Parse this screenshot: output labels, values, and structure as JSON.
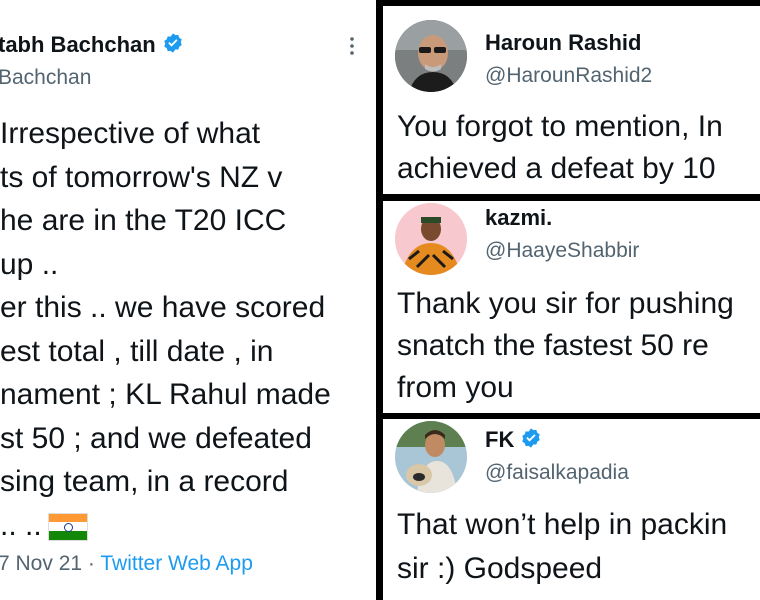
{
  "left_tweet": {
    "name": "tabh Bachchan",
    "handle": "Bachchan",
    "lines": [
      "Irrespective of what",
      "ts of tomorrow's NZ v",
      "he are in the T20 ICC",
      "up ..",
      "er this .. we have scored",
      "est total , till date , in",
      "nament ; KL Rahul made",
      "st 50 ; and we defeated",
      "sing team, in a record",
      ".. .."
    ],
    "date": "7 Nov 21",
    "separator": "·",
    "source": "Twitter Web App"
  },
  "replies": [
    {
      "name": "Haroun Rashid",
      "handle": "@HarounRashid2",
      "lines": [
        "You forgot to mention, In",
        "achieved a defeat by 10"
      ]
    },
    {
      "name": "kazmi.",
      "handle": "@HaayeShabbir",
      "lines": [
        "Thank you sir for pushing",
        "snatch the fastest 50 re",
        "from you"
      ]
    },
    {
      "name": "FK",
      "handle": "@faisalkapadia",
      "lines": [
        "That won’t help in packin",
        "sir :) Godspeed"
      ]
    }
  ],
  "colors": {
    "verified": "#1d9bf0",
    "link": "#1d9bf0",
    "text": "#0f1419",
    "muted": "#536471"
  }
}
